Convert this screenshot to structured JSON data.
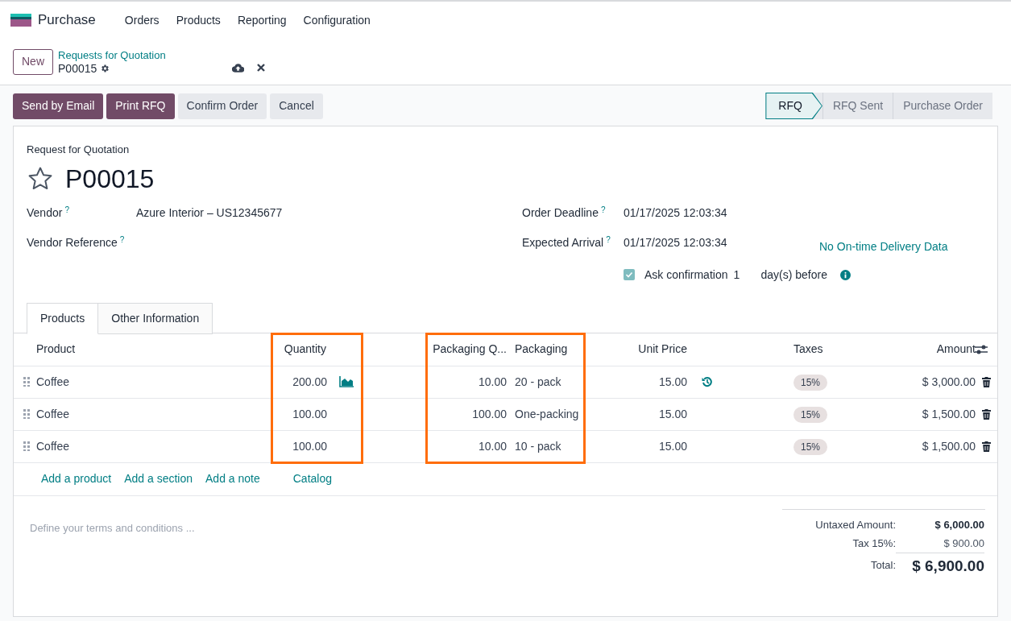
{
  "app": {
    "name": "Purchase",
    "menu": [
      "Orders",
      "Products",
      "Reporting",
      "Configuration"
    ]
  },
  "control_panel": {
    "new_button": "New",
    "breadcrumb": "Requests for Quotation",
    "record": "P00015"
  },
  "actions": [
    {
      "label": "Send by Email",
      "kind": "primary"
    },
    {
      "label": "Print RFQ",
      "kind": "primary"
    },
    {
      "label": "Confirm Order",
      "kind": "secondary"
    },
    {
      "label": "Cancel",
      "kind": "secondary"
    }
  ],
  "status_steps": [
    {
      "label": "RFQ",
      "selected": true
    },
    {
      "label": "RFQ Sent",
      "selected": false
    },
    {
      "label": "Purchase Order",
      "selected": false
    }
  ],
  "form": {
    "subtitle": "Request for Quotation",
    "title": "P00015",
    "starred": false,
    "fields_left": [
      {
        "label": "Vendor",
        "help": "?",
        "value": "Azure Interior – US12345677"
      },
      {
        "label": "Vendor Reference",
        "help": "?"
      }
    ],
    "fields_right": [
      {
        "label": "Order Deadline",
        "help": "?",
        "value": "01/17/2025 12:03:34"
      },
      {
        "label": "Expected Arrival",
        "help": "?",
        "value": "01/17/2025 12:03:34",
        "link": "No On-time Delivery Data"
      }
    ],
    "ask_confirmation": {
      "checked": true,
      "label": "Ask confirmation",
      "days": "1",
      "suffix": "day(s) before"
    }
  },
  "tabs": [
    {
      "label": "Products",
      "selected": true
    },
    {
      "label": "Other Information",
      "selected": false
    }
  ],
  "lines": {
    "columns": [
      {
        "label": "Product",
        "highlighted": false
      },
      {
        "label": "Quantity",
        "highlighted": true
      },
      {
        "label": "Packaging Q...",
        "highlighted": true
      },
      {
        "label": "Packaging",
        "highlighted": true
      },
      {
        "label": "Unit Price",
        "highlighted": false
      },
      {
        "label": "Taxes",
        "highlighted": false
      },
      {
        "label": "Amount",
        "highlighted": false
      }
    ],
    "rows": [
      {
        "product": "Coffee",
        "quantity": "200.00",
        "forecast": true,
        "packaging_qty": "10.00",
        "packaging": "20 - pack",
        "unit_price": "15.00",
        "price_reset": true,
        "tax": "15%",
        "amount": "$ 3,000.00"
      },
      {
        "product": "Coffee",
        "quantity": "100.00",
        "forecast": false,
        "packaging_qty": "100.00",
        "packaging": "One-packing",
        "unit_price": "15.00",
        "price_reset": false,
        "tax": "15%",
        "amount": "$ 1,500.00"
      },
      {
        "product": "Coffee",
        "quantity": "100.00",
        "forecast": false,
        "packaging_qty": "10.00",
        "packaging": "10 - pack",
        "unit_price": "15.00",
        "price_reset": false,
        "tax": "15%",
        "amount": "$ 1,500.00"
      }
    ],
    "add_links": [
      "Add a product",
      "Add a section",
      "Add a note",
      "Catalog"
    ]
  },
  "terms_placeholder": "Define your terms and conditions ...",
  "totals": [
    {
      "label": "Untaxed Amount:",
      "value": "$ 6,000.00",
      "kind": "subtotal"
    },
    {
      "label": "Tax 15%:",
      "value": "$ 900.00",
      "kind": "tax"
    },
    {
      "label": "Total:",
      "value": "$ 6,900.00",
      "kind": "total"
    }
  ]
}
